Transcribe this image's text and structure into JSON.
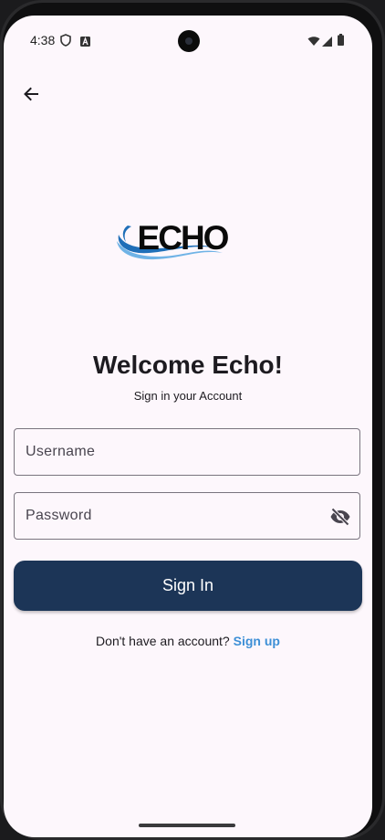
{
  "status_bar": {
    "time": "4:38",
    "icons": [
      "shield-icon",
      "a-badge-icon",
      "wifi-icon",
      "signal-icon",
      "battery-icon"
    ]
  },
  "nav": {
    "back_icon": "arrow-left-icon"
  },
  "logo": {
    "text": "ECHO",
    "colors": {
      "text": "#0a0a0a",
      "wave_dark": "#1f6fb8",
      "wave_light": "#6fb3e6"
    }
  },
  "login": {
    "title": "Welcome Echo!",
    "subtitle": "Sign in your Account",
    "username_placeholder": "Username",
    "password_placeholder": "Password",
    "password_toggle_icon": "eye-off-icon",
    "sign_in_label": "Sign In",
    "signup_prompt": "Don't have an account?",
    "signup_link": "Sign up"
  },
  "colors": {
    "background": "#fdf7fc",
    "primary_button": "#1c3557",
    "link": "#3d8fd6",
    "field_border": "#79747e"
  }
}
